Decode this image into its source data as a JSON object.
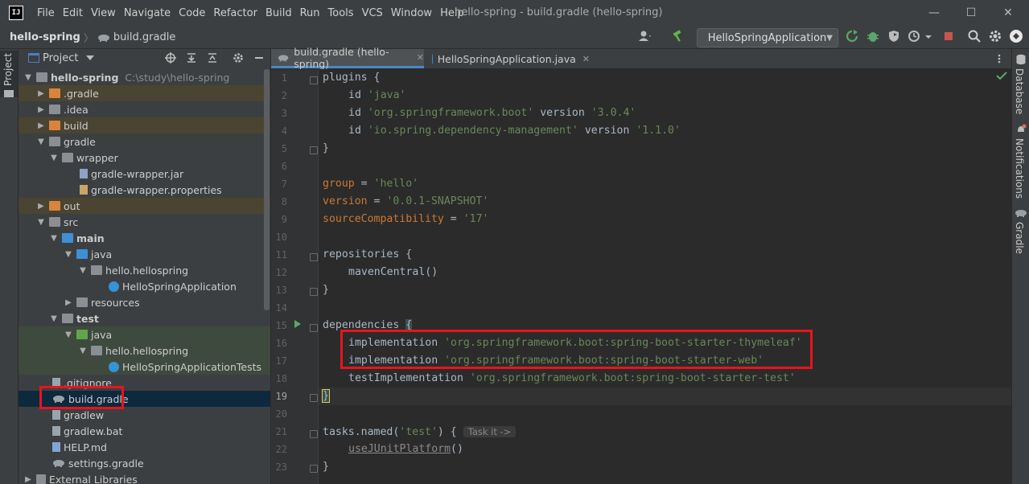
{
  "app": {
    "logo_text": "IJ",
    "window_title": "hello-spring - build.gradle (hello-spring)"
  },
  "menu": [
    "File",
    "Edit",
    "View",
    "Navigate",
    "Code",
    "Refactor",
    "Build",
    "Run",
    "Tools",
    "VCS",
    "Window",
    "Help"
  ],
  "window_buttons": {
    "minimize": "—",
    "maximize": "☐",
    "close": "✕"
  },
  "breadcrumb": {
    "project": "hello-spring",
    "separator": "〉",
    "file": "build.gradle"
  },
  "run_config": {
    "label": "HelloSpringApplication",
    "chevron": "▼"
  },
  "left_strip": {
    "project_tab": "Project"
  },
  "project_panel": {
    "title": "Project",
    "tree": [
      {
        "label": "hello-spring",
        "path": "C:\\study\\hello-spring",
        "arrow": "▼",
        "bold": true
      },
      {
        "label": ".gradle",
        "arrow": "▶"
      },
      {
        "label": ".idea",
        "arrow": "▶"
      },
      {
        "label": "build",
        "arrow": "▶"
      },
      {
        "label": "gradle",
        "arrow": "▼"
      },
      {
        "label": "wrapper",
        "arrow": "▼"
      },
      {
        "label": "gradle-wrapper.jar",
        "arrow": ""
      },
      {
        "label": "gradle-wrapper.properties",
        "arrow": ""
      },
      {
        "label": "out",
        "arrow": "▶"
      },
      {
        "label": "src",
        "arrow": "▼"
      },
      {
        "label": "main",
        "arrow": "▼",
        "bold": true
      },
      {
        "label": "java",
        "arrow": "▼"
      },
      {
        "label": "hello.hellospring",
        "arrow": "▼"
      },
      {
        "label": "HelloSpringApplication",
        "arrow": ""
      },
      {
        "label": "resources",
        "arrow": "▶"
      },
      {
        "label": "test",
        "arrow": "▼",
        "bold": true
      },
      {
        "label": "java",
        "arrow": "▼"
      },
      {
        "label": "hello.hellospring",
        "arrow": "▼"
      },
      {
        "label": "HelloSpringApplicationTests",
        "arrow": ""
      },
      {
        "label": ".gitignore",
        "arrow": ""
      },
      {
        "label": "build.gradle",
        "arrow": ""
      },
      {
        "label": "gradlew",
        "arrow": ""
      },
      {
        "label": "gradlew.bat",
        "arrow": ""
      },
      {
        "label": "HELP.md",
        "arrow": ""
      },
      {
        "label": "settings.gradle",
        "arrow": ""
      },
      {
        "label": "External Libraries",
        "arrow": "▶"
      }
    ]
  },
  "tabs": [
    {
      "label": "build.gradle (hello-spring)",
      "close": "✕",
      "active": true
    },
    {
      "label": "HelloSpringApplication.java",
      "close": "✕",
      "active": false
    }
  ],
  "editor": {
    "line_numbers": [
      "1",
      "2",
      "3",
      "4",
      "5",
      "6",
      "7",
      "8",
      "9",
      "10",
      "11",
      "12",
      "13",
      "14",
      "15",
      "16",
      "17",
      "18",
      "19",
      "20",
      "21",
      "22",
      "23"
    ],
    "lines": {
      "l1_kw": "plugins",
      "l1_rest": " {",
      "l2_kw": "id",
      "l2_str": "'java'",
      "l3_kw": "id",
      "l3_str": "'org.springframework.boot'",
      "l3_kw2": "version",
      "l3_str2": "'3.0.4'",
      "l4_kw": "id",
      "l4_str": "'io.spring.dependency-management'",
      "l4_kw2": "version",
      "l4_str2": "'1.1.0'",
      "l5": "}",
      "l7_kw": "group",
      "l7_op": " = ",
      "l7_str": "'hello'",
      "l8_kw": "version",
      "l8_op": " = ",
      "l8_str": "'0.0.1-SNAPSHOT'",
      "l9_kw": "sourceCompatibility",
      "l9_op": " = ",
      "l9_str": "'17'",
      "l11_kw": "repositories",
      "l11_rest": " {",
      "l12_fn": "mavenCentral()",
      "l13": "}",
      "l15_kw": "dependencies",
      "l15_rest": "{",
      "l16_fn": "implementation",
      "l16_str": "'org.springframework.boot:spring-boot-starter-thymeleaf'",
      "l17_fn": "implementation",
      "l17_str": "'org.springframework.boot:spring-boot-starter-web'",
      "l18_fn": "testImplementation",
      "l18_str": "'org.springframework.boot:spring-boot-starter-test'",
      "l19": "}",
      "l21_kw": "tasks",
      "l21_fn": ".named(",
      "l21_str": "'test'",
      "l21_rest": ") {",
      "l21_inlay": "Task it ->",
      "l22_fn": "useJUnitPlatform",
      "l22_rest": "()",
      "l23": "}"
    }
  },
  "right_strip": {
    "database": "Database",
    "notifications": "Notifications",
    "gradle": "Gradle"
  }
}
